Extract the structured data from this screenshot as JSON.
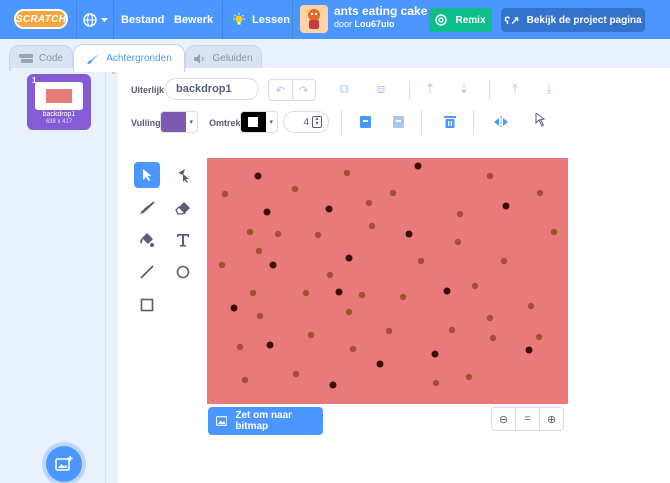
{
  "menubar": {
    "logo": "SCRATCH",
    "bestand": "Bestand",
    "bewerk": "Bewerk",
    "lessen": "Lessen",
    "project_title": "ants eating cake",
    "author_prefix": "door",
    "author": "Lou67uio",
    "remix": "Remix",
    "project_page": "Bekijk de project pagina"
  },
  "tabs": [
    {
      "label": "Code",
      "icon": "code-icon"
    },
    {
      "label": "Achtergronden",
      "icon": "brush-icon",
      "active": true
    },
    {
      "label": "Geluiden",
      "icon": "speaker-icon"
    }
  ],
  "costumes": [
    {
      "index": "1",
      "name": "backdrop1",
      "size": "638 x 417",
      "thumb_color": "#e87a7a"
    }
  ],
  "paint": {
    "uiterlijk_label": "Uiterlijk",
    "costume_name": "backdrop1",
    "vulling_label": "Vulling",
    "fill_color": "#7b5bb0",
    "omtrek_label": "Omtrek",
    "outline_color": "#000000",
    "stroke_width": "4",
    "canvas_color": "#e87a7a",
    "convert_bitmap": "Zet om naar bitmap",
    "zoom_reset": "="
  },
  "colors": {
    "accent": "#4c97ff",
    "remix": "#0fbd8c",
    "selected_costume": "#855cd6",
    "dot_light": "#a0522d",
    "dot_dark": "#3a0f08"
  }
}
